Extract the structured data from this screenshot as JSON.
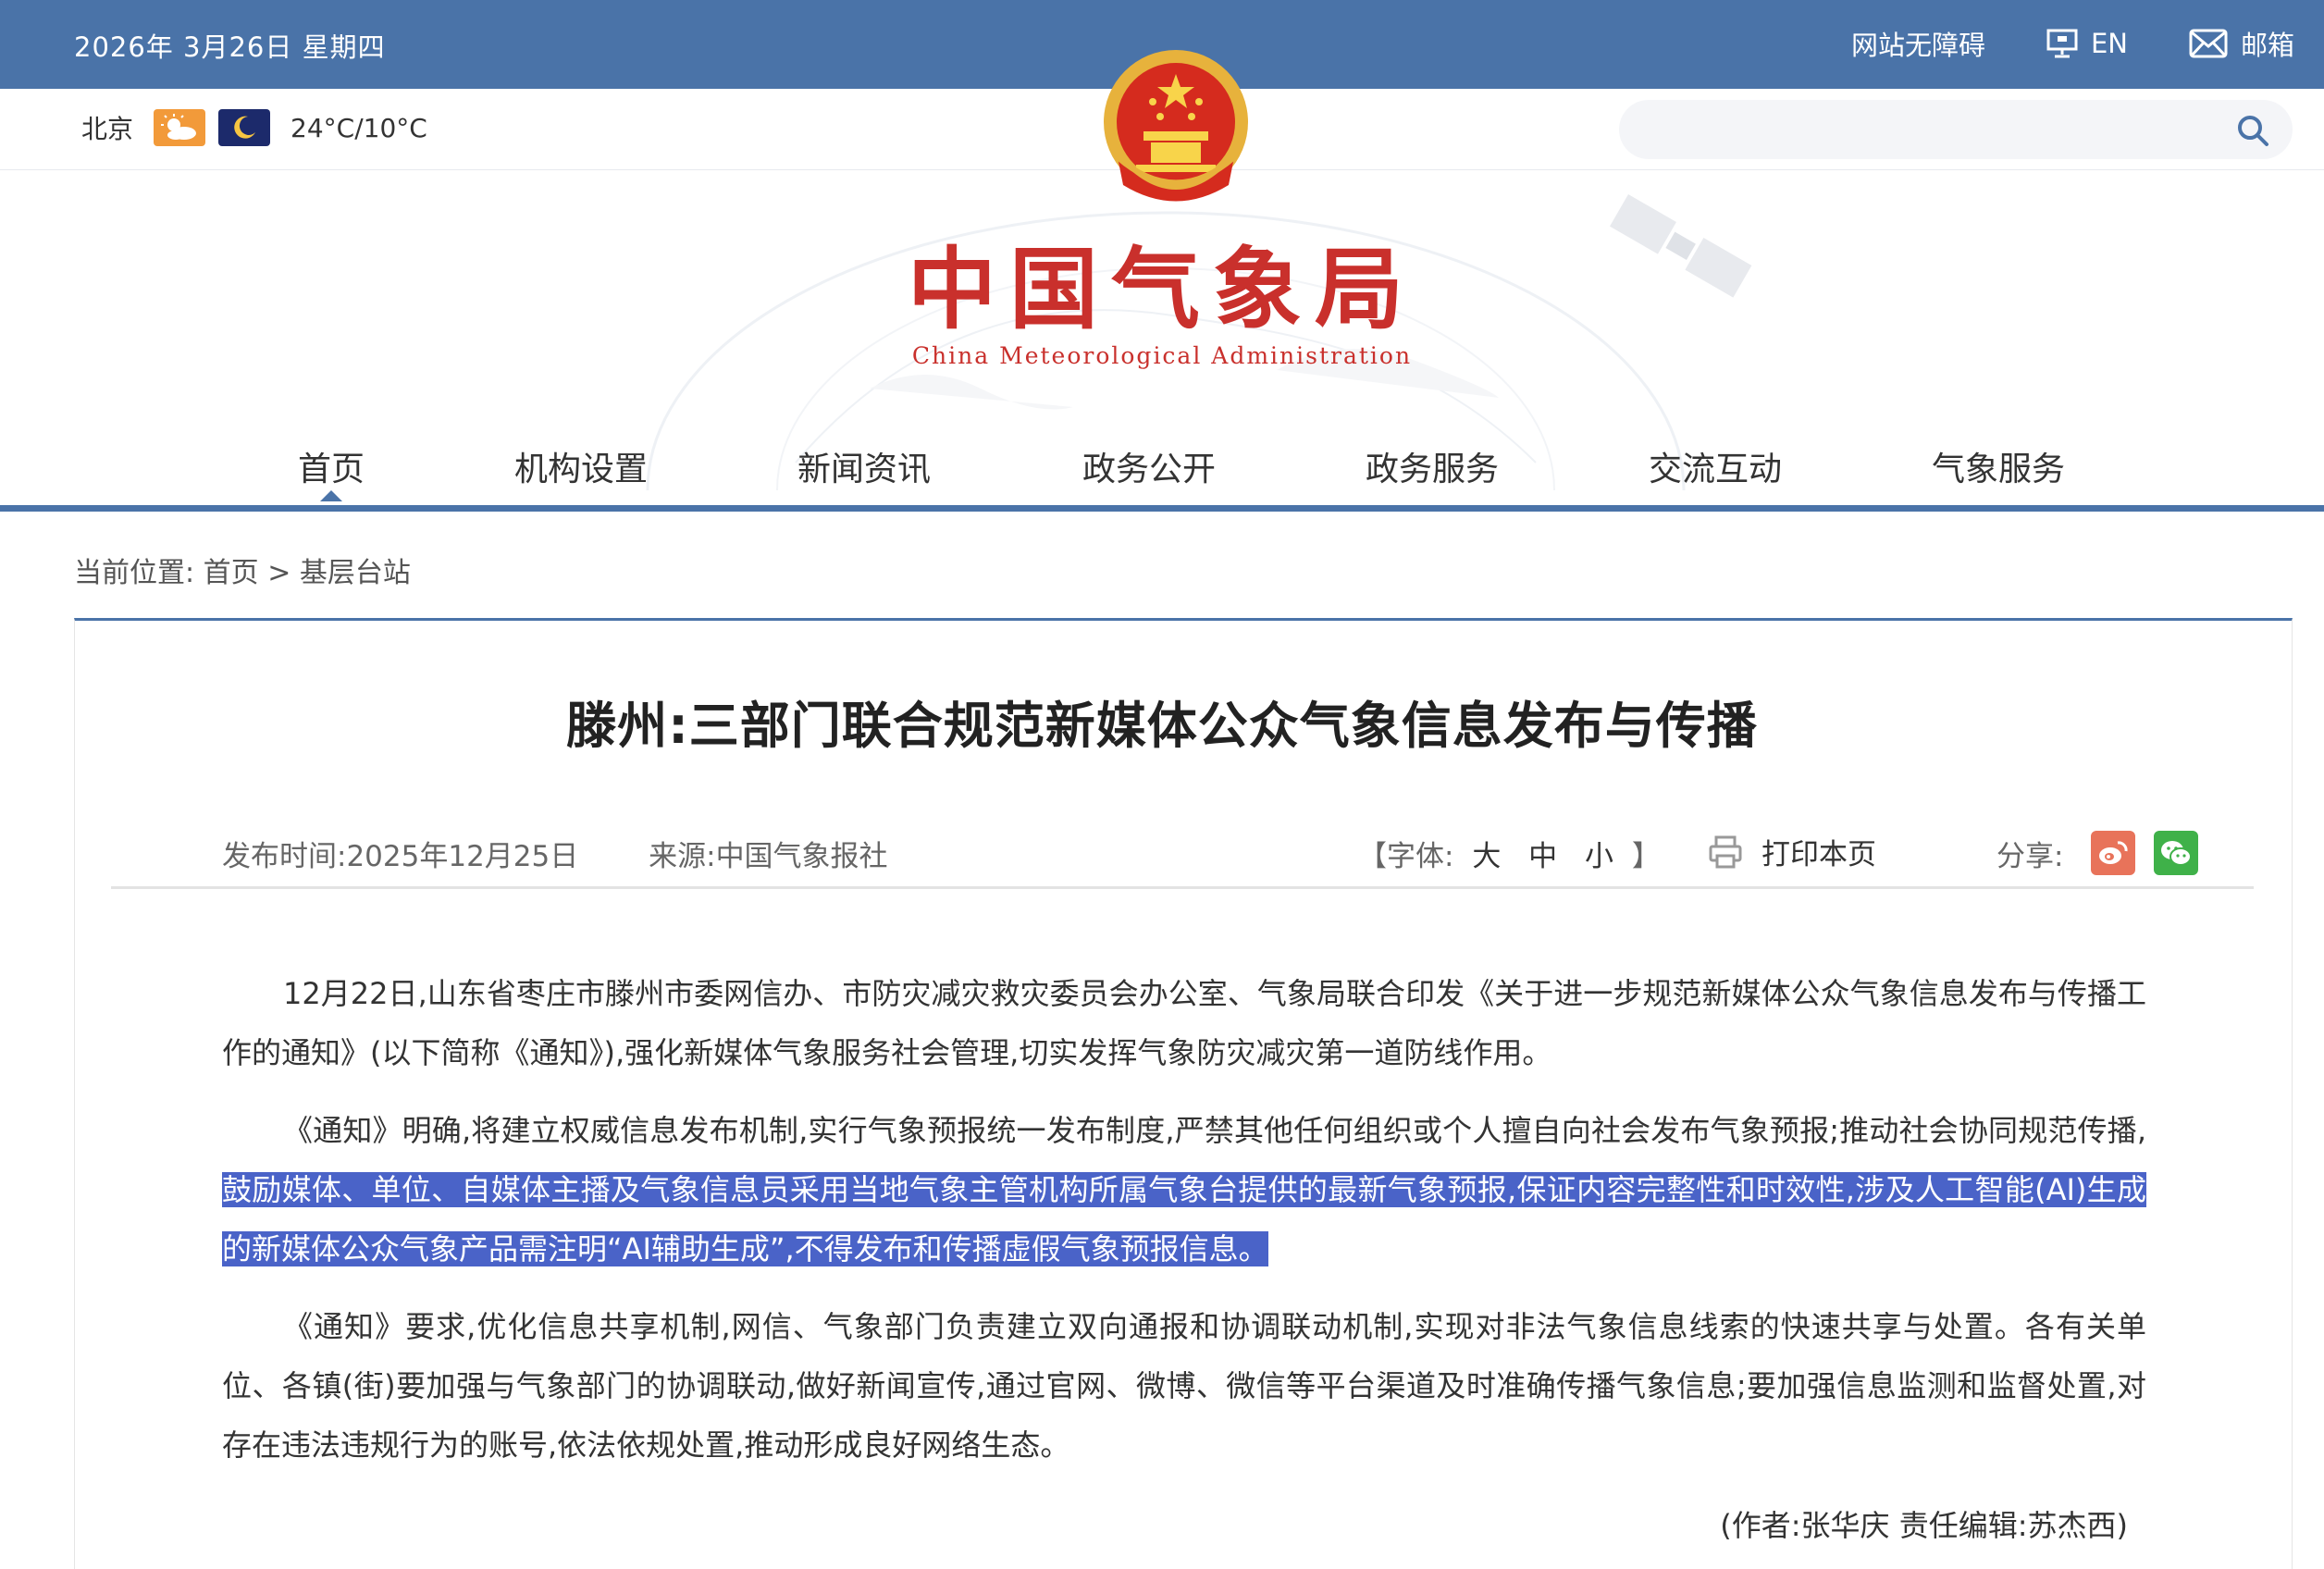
{
  "topbar": {
    "date": "2026年 3月26日 星期四",
    "accessibility": "网站无障碍",
    "english": "EN",
    "mail": "邮箱"
  },
  "weather": {
    "city": "北京",
    "day_icon": "partly-cloudy-icon",
    "night_icon": "moon-icon",
    "temperature": "24°C/10°C"
  },
  "search": {
    "placeholder": ""
  },
  "brand": {
    "name_cn": "中国气象局",
    "name_en": "China Meteorological Administration"
  },
  "nav": {
    "items": [
      "首页",
      "机构设置",
      "新闻资讯",
      "政务公开",
      "政务服务",
      "交流互动",
      "气象服务"
    ],
    "active": "首页"
  },
  "breadcrumb": {
    "label": "当前位置:",
    "home": "首页",
    "separator": ">",
    "current": "基层台站"
  },
  "article": {
    "title": "滕州:三部门联合规范新媒体公众气象信息发布与传播",
    "publish_label": "发布时间:",
    "publish_date": "2025年12月25日",
    "source_label": "来源:",
    "source": "中国气象报社",
    "font_label": "【字体:",
    "font_large": "大",
    "font_medium": "中",
    "font_small": "小",
    "font_close": "】",
    "print_label": "打印本页",
    "share_label": "分享:",
    "p1": "12月22日,山东省枣庄市滕州市委网信办、市防灾减灾救灾委员会办公室、气象局联合印发《关于进一步规范新媒体公众气象信息发布与传播工作的通知》(以下简称《通知》),强化新媒体气象服务社会管理,切实发挥气象防灾减灾第一道防线作用。",
    "p2_start": "《通知》明确,将建立权威信息发布机制,实行气象预报统一发布制度,严禁其他任何组织或个人擅自向社会发布气象预报;推动社会协同规范传播,",
    "p2_selected": "鼓励媒体、单位、自媒体主播及气象信息员采用当地气象主管机构所属气象台提供的最新气象预报,保证内容完整性和时效性,涉及人工智能(AI)生成的新媒体公众气象产品需注明“AI辅助生成”,不得发布和传播虚假气象预报信息。",
    "p3": "《通知》要求,优化信息共享机制,网信、气象部门负责建立双向通报和协调联动机制,实现对非法气象信息线索的快速共享与处置。各有关单位、各镇(街)要加强与气象部门的协调联动,做好新闻宣传,通过官网、微博、微信等平台渠道及时准确传播气象信息;要加强信息监测和监督处置,对存在违法违规行为的账号,依法依规处置,推动形成良好网络生态。",
    "author": "(作者:张华庆 责任编辑:苏杰西)"
  },
  "colors": {
    "primary": "#4a73a8",
    "brand_red": "#c9302c",
    "selection": "#4a63c8",
    "weibo": "#e8735a",
    "wechat": "#3fb149"
  }
}
